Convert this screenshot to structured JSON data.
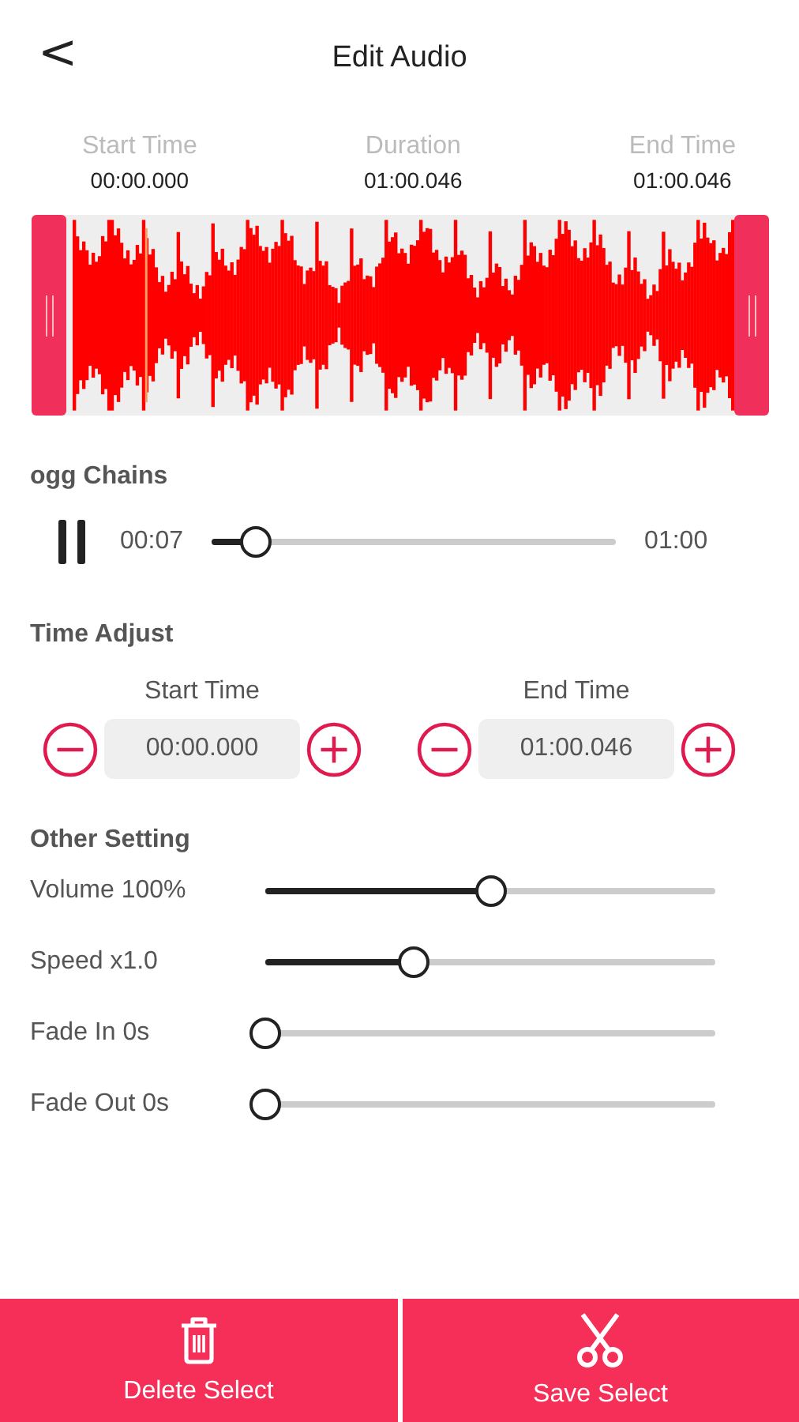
{
  "header": {
    "back_icon": "<",
    "title": "Edit Audio"
  },
  "summary": [
    {
      "label": "Start Time",
      "value": "00:00.000"
    },
    {
      "label": "Duration",
      "value": "01:00.046"
    },
    {
      "label": "End Time",
      "value": "01:00.046"
    }
  ],
  "track": {
    "name": "ogg  Chains",
    "playing": true,
    "current": "00:07",
    "total": "01:00",
    "level": 0.11
  },
  "time_adjust": {
    "title": "Time Adjust",
    "fields": [
      {
        "label": "Start Time",
        "value": "00:00.000"
      },
      {
        "label": "End Time",
        "value": "01:00.046"
      }
    ]
  },
  "other_setting": {
    "title": "Other Setting",
    "sliders": [
      {
        "label": "Volume 100%",
        "level": 0.5
      },
      {
        "label": "Speed x1.0",
        "level": 0.33
      },
      {
        "label": "Fade In 0s",
        "level": 0
      },
      {
        "label": "Fade Out 0s",
        "level": 0
      }
    ]
  },
  "buttons": [
    {
      "kind": "delete",
      "label": "Delete Select"
    },
    {
      "kind": "save",
      "label": "Save Select"
    }
  ]
}
